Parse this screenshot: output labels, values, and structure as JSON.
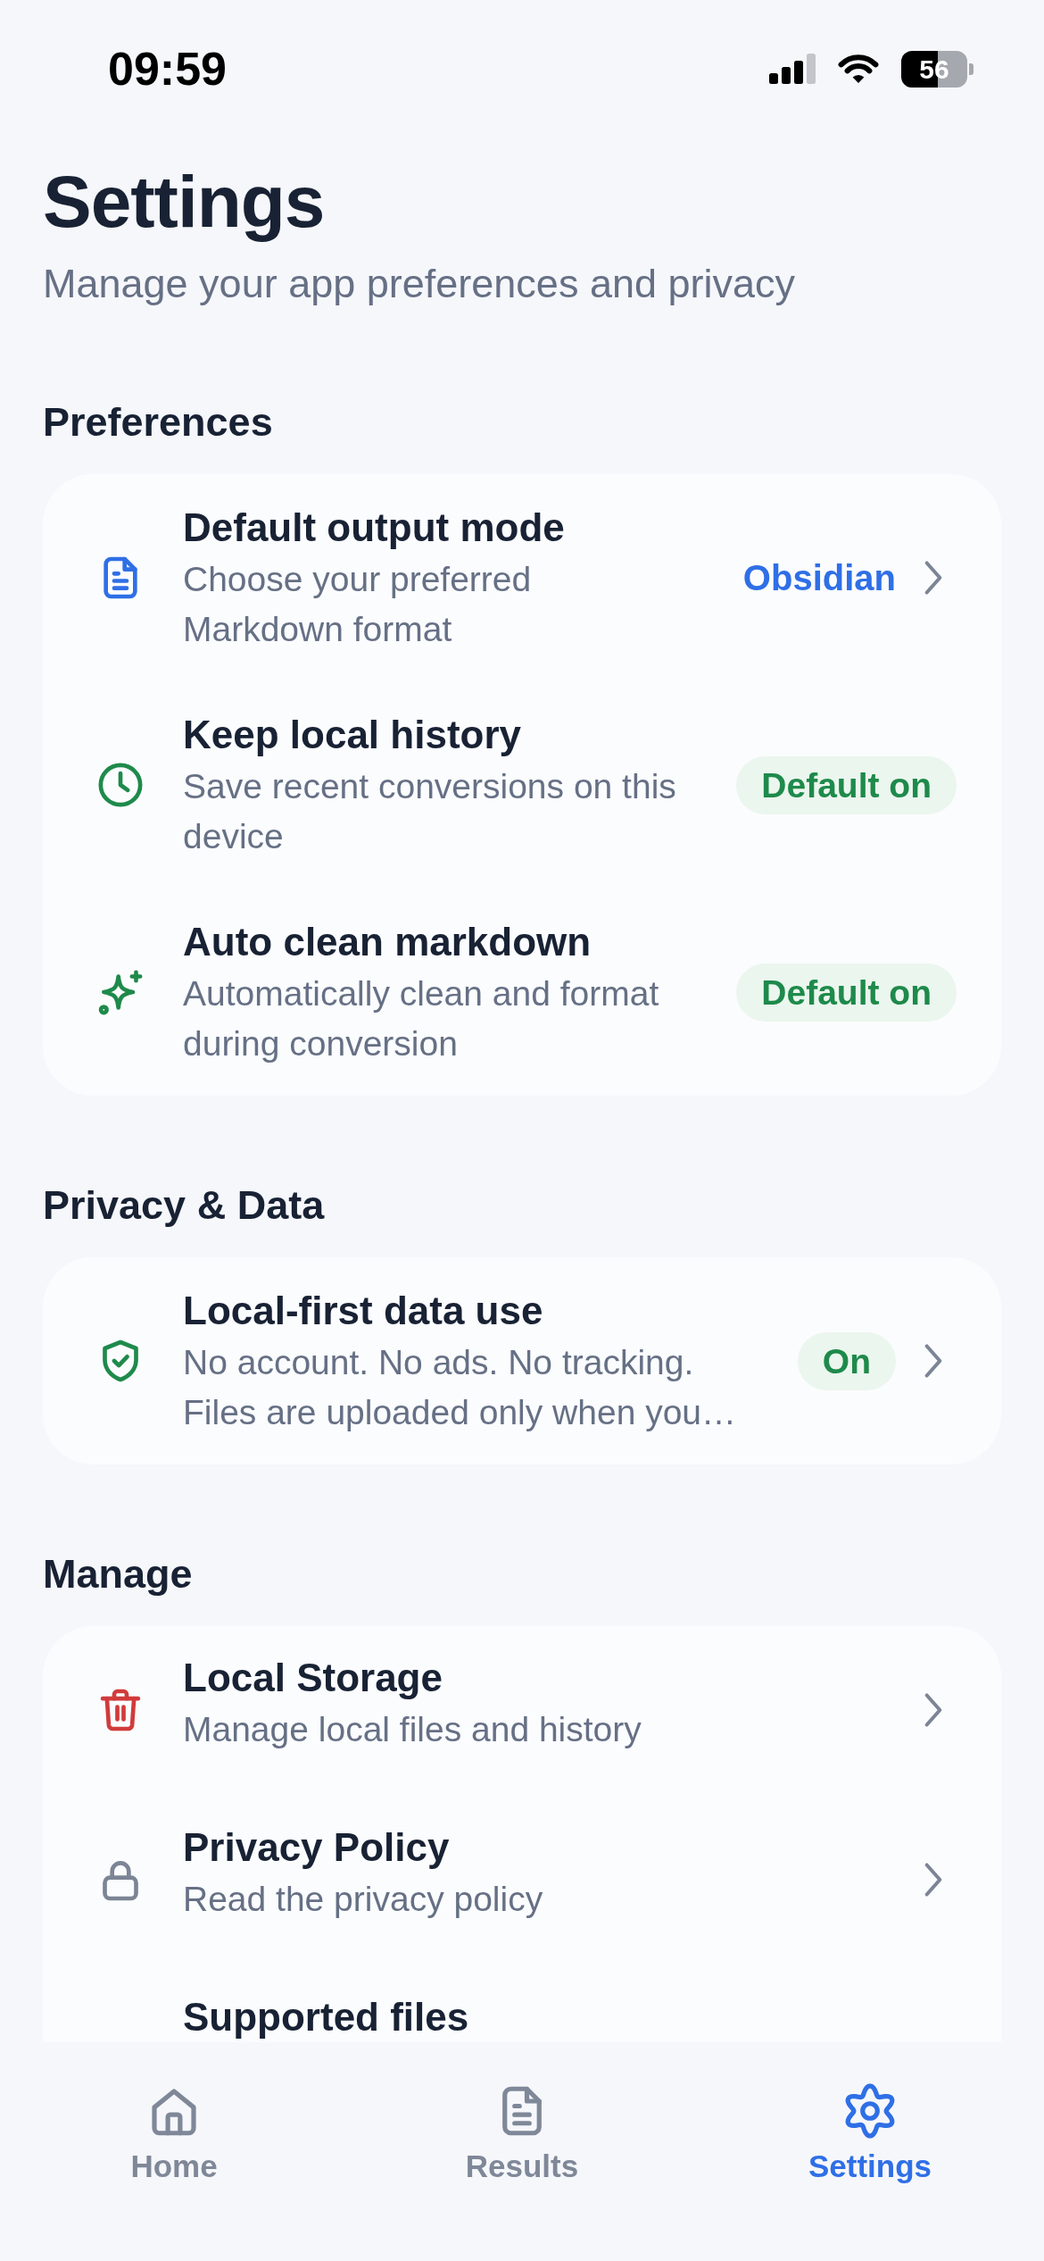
{
  "status_bar": {
    "time": "09:59",
    "battery": "56"
  },
  "header": {
    "title": "Settings",
    "subtitle": "Manage your app preferences and privacy"
  },
  "sections": [
    {
      "title": "Preferences",
      "rows": [
        {
          "title": "Default output mode",
          "subtitle": "Choose your preferred Markdown format",
          "value": "Obsidian",
          "chevron": true
        },
        {
          "title": "Keep local history",
          "subtitle": "Save recent conversions on this device",
          "badge": "Default on",
          "chevron": false
        },
        {
          "title": "Auto clean markdown",
          "subtitle": "Automatically clean and format during conversion",
          "badge": "Default on",
          "chevron": false
        }
      ]
    },
    {
      "title": "Privacy & Data",
      "rows": [
        {
          "title": "Local-first data use",
          "subtitle": "No account. No ads. No tracking. Files are uploaded only when you…",
          "badge": "On",
          "chevron": true
        }
      ]
    },
    {
      "title": "Manage",
      "rows": [
        {
          "title": "Local Storage",
          "subtitle": "Manage local files and history",
          "chevron": true
        },
        {
          "title": "Privacy Policy",
          "subtitle": "Read the privacy policy",
          "chevron": true
        },
        {
          "title": "Supported files",
          "chevron": false
        }
      ]
    }
  ],
  "tab_bar": {
    "tabs": [
      {
        "label": "Home",
        "selected": false
      },
      {
        "label": "Results",
        "selected": false
      },
      {
        "label": "Settings",
        "selected": true
      }
    ]
  }
}
